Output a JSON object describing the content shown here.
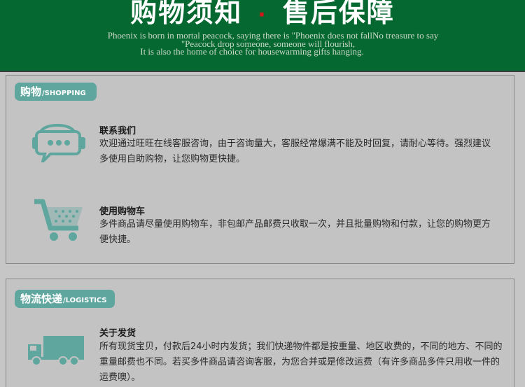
{
  "header": {
    "title_left": "购物须知",
    "separator": "·",
    "title_right": "售后保障",
    "tagline_lines": [
      "Phoenix is born in mortal peacock, saying there is \"Phoenix does not fallNo treasure to say",
      "\"Peacock drop someone, someone will flourish,",
      "It is also the home of choice for housewarming gifts hanging."
    ]
  },
  "sections": [
    {
      "tag_cn": "购物",
      "tag_en": "/SHOPPING",
      "items": [
        {
          "icon": "headset-chat-icon",
          "title": "联系我们",
          "text": "欢迎通过旺旺在线客服咨询，由于咨询量大，客服经常爆满不能及时回复，请耐心等待。强烈建议多使用自助购物，让您购物更快捷。"
        },
        {
          "icon": "shopping-cart-icon",
          "title": "使用购物车",
          "text": "多件商品请尽量使用购物车，非包邮产品邮费只收取一次，并且批量购物和付款，让您的购物更方便快捷。"
        }
      ]
    },
    {
      "tag_cn": "物流快递",
      "tag_en": "/LOGISTICS",
      "items": [
        {
          "icon": "delivery-truck-icon",
          "title": "关于发货",
          "text": "所有现货宝贝，付款后24小时内发货；我们快递物件都是按重量、地区收费的，不同的地方、不同的重量邮费也不同。若买多件商品请咨询客服，为您合并或是修改运费（有许多商品多件只用收一件的运费噢）。"
        }
      ]
    }
  ],
  "colors": {
    "header_bg": "#046830",
    "accent": "#5fa69f",
    "separator": "#d01818",
    "page_bg": "#c6c6c6"
  }
}
